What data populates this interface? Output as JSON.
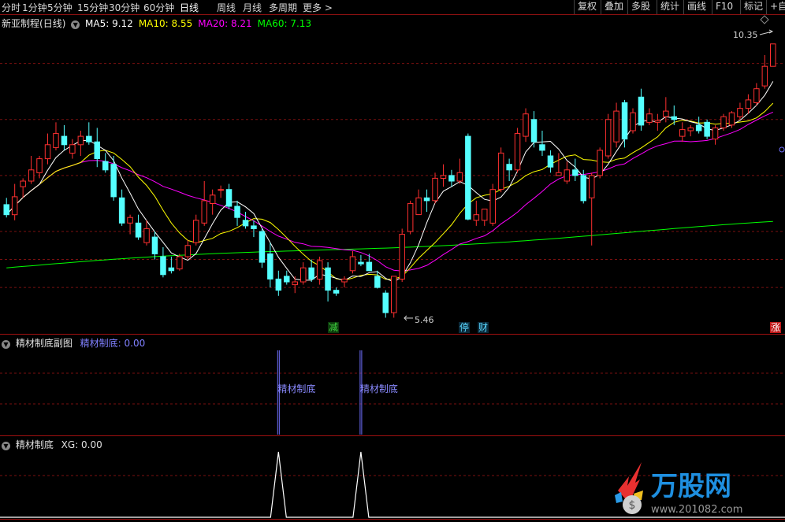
{
  "toolbar": {
    "periods": [
      "分时",
      "1分钟",
      "5分钟",
      "15分钟",
      "30分钟",
      "60分钟",
      "日线",
      "周线",
      "月线",
      "多周期",
      "更多 >"
    ],
    "active_period": "日线",
    "right_buttons": [
      "复权",
      "叠加",
      "多股",
      "统计",
      "画线",
      "F10",
      "标记",
      "+自"
    ]
  },
  "main_panel": {
    "stock_name": "新亚制程",
    "period_label": "(日线)",
    "ma": [
      {
        "label": "MA5:",
        "value": "9.12",
        "color": "#ffffff"
      },
      {
        "label": "MA10:",
        "value": "8.55",
        "color": "#ffff00"
      },
      {
        "label": "MA20:",
        "value": "8.21",
        "color": "#ff00ff"
      },
      {
        "label": "MA60:",
        "value": "7.13",
        "color": "#00ff00"
      }
    ],
    "high_label": "10.35",
    "low_label": "5.46",
    "markers": [
      {
        "text": "减",
        "color": "#40d040",
        "bg": "#0c3a0c"
      },
      {
        "text": "停",
        "color": "#5ad8ff",
        "bg": "#0b2a3a"
      },
      {
        "text": "财",
        "color": "#5ad8ff",
        "bg": "#0b2a3a"
      },
      {
        "text": "涨",
        "color": "#ffffff",
        "bg": "#c01818"
      }
    ]
  },
  "sub_panel_1": {
    "title": "精材制底副图",
    "indicator_label": "精材制底: 0.00",
    "signal_labels": [
      "精材制底",
      "精材制底"
    ]
  },
  "sub_panel_2": {
    "title": "精材制底",
    "indicator_label": "XG: 0.00"
  },
  "watermark": {
    "brand": "万股网",
    "url": "www.201082.com"
  },
  "colors": {
    "up": "#ff3030",
    "down": "#54ffff",
    "ma5": "#ffffff",
    "ma10": "#ffff00",
    "ma20": "#ff00ff",
    "ma60": "#00ff00",
    "signal": "#7070ff"
  },
  "chart_data": {
    "type": "candlestick",
    "period": "daily",
    "ohlc": [
      [
        7.48,
        7.6,
        7.25,
        7.3
      ],
      [
        7.3,
        7.85,
        7.2,
        7.62
      ],
      [
        7.8,
        7.95,
        7.6,
        7.9
      ],
      [
        7.9,
        8.35,
        7.85,
        8.1
      ],
      [
        8.05,
        8.35,
        7.95,
        8.3
      ],
      [
        8.3,
        8.75,
        8.2,
        8.55
      ],
      [
        8.5,
        8.95,
        8.45,
        8.75
      ],
      [
        8.7,
        8.9,
        8.45,
        8.55
      ],
      [
        8.4,
        8.65,
        8.3,
        8.55
      ],
      [
        8.55,
        8.8,
        8.35,
        8.7
      ],
      [
        8.7,
        8.95,
        8.55,
        8.6
      ],
      [
        8.6,
        8.85,
        8.15,
        8.3
      ],
      [
        8.25,
        8.4,
        8.05,
        8.1
      ],
      [
        8.2,
        8.35,
        7.55,
        7.62
      ],
      [
        7.6,
        7.75,
        7.1,
        7.15
      ],
      [
        7.15,
        7.3,
        6.95,
        7.25
      ],
      [
        7.15,
        7.3,
        6.85,
        6.9
      ],
      [
        6.8,
        7.2,
        6.75,
        7.05
      ],
      [
        6.9,
        7.0,
        6.5,
        6.6
      ],
      [
        6.55,
        6.72,
        6.18,
        6.23
      ],
      [
        6.35,
        6.55,
        6.25,
        6.3
      ],
      [
        6.33,
        6.6,
        6.3,
        6.55
      ],
      [
        6.55,
        6.85,
        6.5,
        6.75
      ],
      [
        6.8,
        7.3,
        6.75,
        7.2
      ],
      [
        7.15,
        7.9,
        7.1,
        7.55
      ],
      [
        7.5,
        7.75,
        7.3,
        7.65
      ],
      [
        7.75,
        7.82,
        7.6,
        7.75
      ],
      [
        7.75,
        7.85,
        7.4,
        7.45
      ],
      [
        7.45,
        7.55,
        7.1,
        7.25
      ],
      [
        7.2,
        7.35,
        7.05,
        7.1
      ],
      [
        7.1,
        7.2,
        6.9,
        7.05
      ],
      [
        7.0,
        7.05,
        6.35,
        6.45
      ],
      [
        6.6,
        6.8,
        6.0,
        6.15
      ],
      [
        6.15,
        6.3,
        5.85,
        5.95
      ],
      [
        6.2,
        6.3,
        6.05,
        6.1
      ],
      [
        6.05,
        6.2,
        5.9,
        6.1
      ],
      [
        6.1,
        6.45,
        6.05,
        6.35
      ],
      [
        6.35,
        6.5,
        6.1,
        6.15
      ],
      [
        6.15,
        6.55,
        6.05,
        6.48
      ],
      [
        6.35,
        6.45,
        5.75,
        5.95
      ],
      [
        5.95,
        6.0,
        5.85,
        5.9
      ],
      [
        6.1,
        6.2,
        6.0,
        6.15
      ],
      [
        6.3,
        6.65,
        6.25,
        6.55
      ],
      [
        6.45,
        6.58,
        6.38,
        6.42
      ],
      [
        6.45,
        6.6,
        6.3,
        6.3
      ],
      [
        6.2,
        6.3,
        5.98,
        6.0
      ],
      [
        5.9,
        5.95,
        5.46,
        5.55
      ],
      [
        5.55,
        6.2,
        5.46,
        6.2
      ],
      [
        6.15,
        7.05,
        6.1,
        6.95
      ],
      [
        7.0,
        7.55,
        6.95,
        7.5
      ],
      [
        7.3,
        7.75,
        7.3,
        7.6
      ],
      [
        7.6,
        7.75,
        7.35,
        7.55
      ],
      [
        7.55,
        8.05,
        7.5,
        7.95
      ],
      [
        7.95,
        8.2,
        7.8,
        8.0
      ],
      [
        8.0,
        8.1,
        7.8,
        7.9
      ],
      [
        7.9,
        8.3,
        7.85,
        8.05
      ],
      [
        8.7,
        8.75,
        7.2,
        7.22
      ],
      [
        7.2,
        7.55,
        7.1,
        7.3
      ],
      [
        7.2,
        7.4,
        7.1,
        7.4
      ],
      [
        7.15,
        7.85,
        7.1,
        7.75
      ],
      [
        7.75,
        8.5,
        7.7,
        8.4
      ],
      [
        8.2,
        8.3,
        7.9,
        8.1
      ],
      [
        8.1,
        8.85,
        8.05,
        8.75
      ],
      [
        8.7,
        9.2,
        8.6,
        9.1
      ],
      [
        9.0,
        9.15,
        8.5,
        8.6
      ],
      [
        8.55,
        8.8,
        8.35,
        8.45
      ],
      [
        8.35,
        8.45,
        8.05,
        8.15
      ],
      [
        8.0,
        8.4,
        8.0,
        8.05
      ],
      [
        7.9,
        8.25,
        7.85,
        8.1
      ],
      [
        8.1,
        8.3,
        7.9,
        8.0
      ],
      [
        8.0,
        8.1,
        7.5,
        7.55
      ],
      [
        7.6,
        8.05,
        6.75,
        8.0
      ],
      [
        8.0,
        8.5,
        7.95,
        8.45
      ],
      [
        8.35,
        9.1,
        8.3,
        9.0
      ],
      [
        8.6,
        9.3,
        8.5,
        9.15
      ],
      [
        9.3,
        9.35,
        8.5,
        8.65
      ],
      [
        8.8,
        9.2,
        8.75,
        9.12
      ],
      [
        9.4,
        9.55,
        8.8,
        8.9
      ],
      [
        8.95,
        9.2,
        8.9,
        9.1
      ],
      [
        8.95,
        9.1,
        8.8,
        8.98
      ],
      [
        9.05,
        9.4,
        8.95,
        9.15
      ],
      [
        9.05,
        9.25,
        8.9,
        9.0
      ],
      [
        8.7,
        8.95,
        8.6,
        8.82
      ],
      [
        8.8,
        8.9,
        8.7,
        8.85
      ],
      [
        8.9,
        9.05,
        8.75,
        8.8
      ],
      [
        8.95,
        9.0,
        8.65,
        8.7
      ],
      [
        8.65,
        8.9,
        8.55,
        8.85
      ],
      [
        8.85,
        9.1,
        8.8,
        9.05
      ],
      [
        8.9,
        9.15,
        8.85,
        9.12
      ],
      [
        9.05,
        9.3,
        9.0,
        9.2
      ],
      [
        9.2,
        9.45,
        9.1,
        9.35
      ],
      [
        9.3,
        9.65,
        9.25,
        9.55
      ],
      [
        9.6,
        10.15,
        9.55,
        9.95
      ],
      [
        9.95,
        10.35,
        9.95,
        10.35
      ]
    ],
    "ma_current": {
      "MA5": 9.12,
      "MA10": 8.55,
      "MA20": 8.21,
      "MA60": 7.13
    },
    "indicator": {
      "name": "精材制底",
      "current": 0.0,
      "signal_bars": [
        33,
        43
      ]
    },
    "xg": {
      "name": "XG",
      "current": 0.0,
      "spikes": [
        33,
        43
      ],
      "value_on_signal": 1.0
    }
  }
}
